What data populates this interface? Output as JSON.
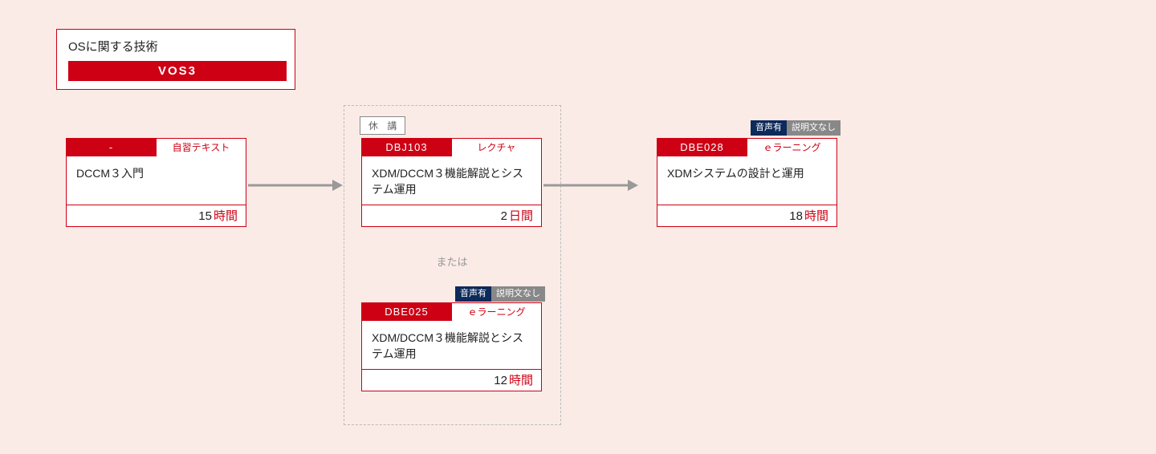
{
  "category": {
    "title": "OSに関する技術",
    "banner": "VOS3"
  },
  "card1": {
    "code": "-",
    "type": "自習テキスト",
    "title": "DCCM３入門",
    "duration_value": "15",
    "duration_unit": "時間"
  },
  "group": {
    "status": "休 講",
    "or_text": "または"
  },
  "card2": {
    "code": "DBJ103",
    "type": "レクチャ",
    "title": "XDM/DCCM３機能解説とシステム運用",
    "duration_value": "2",
    "duration_unit": "日間"
  },
  "card3": {
    "code": "DBE025",
    "type": "ｅラーニング",
    "title": "XDM/DCCM３機能解説とシステム運用",
    "duration_value": "12",
    "duration_unit": "時間",
    "tag_audio": "音声有",
    "tag_desc": "説明文なし"
  },
  "card4": {
    "code": "DBE028",
    "type": "ｅラーニング",
    "title": "XDMシステムの設計と運用",
    "duration_value": "18",
    "duration_unit": "時間",
    "tag_audio": "音声有",
    "tag_desc": "説明文なし"
  }
}
